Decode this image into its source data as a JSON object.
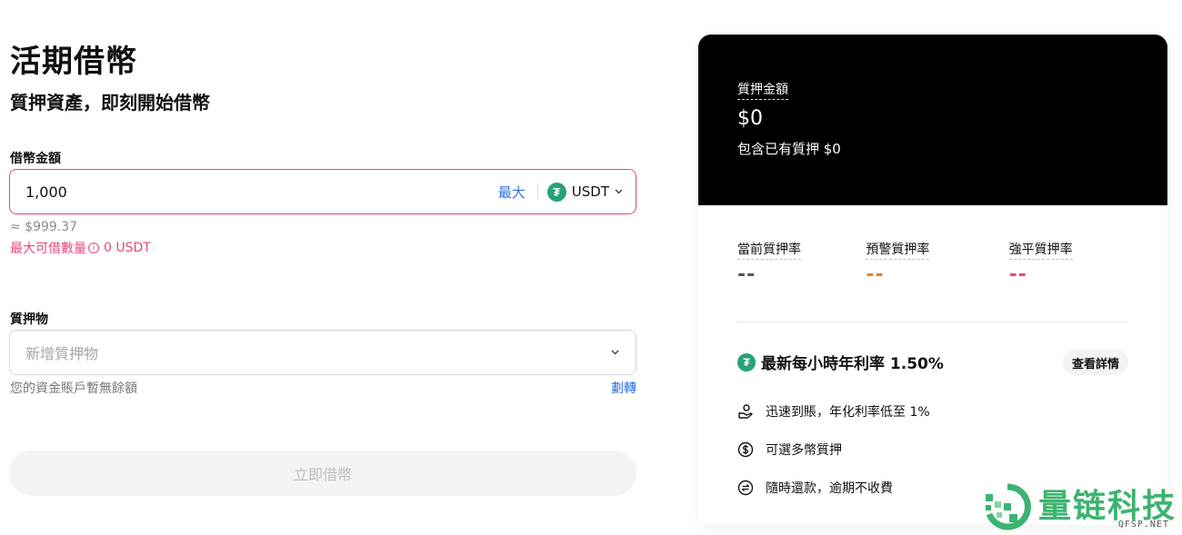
{
  "header": {
    "title": "活期借幣",
    "subtitle": "質押資產，即刻開始借幣"
  },
  "borrow": {
    "label": "借幣金額",
    "amount": "1,000",
    "max_label": "最大",
    "coin": "USDT",
    "approx": "≈ $999.37",
    "max_borrow_label": "最大可借數量",
    "max_borrow_value": "0 USDT"
  },
  "collateral": {
    "label": "質押物",
    "placeholder": "新增質押物",
    "no_balance": "您的資金賬戶暫無餘額",
    "transfer_label": "劃轉"
  },
  "submit_label": "立即借幣",
  "card": {
    "collateral_amount_label": "質押金額",
    "collateral_amount": "$0",
    "existing_collateral": "包含已有質押 $0",
    "rates": [
      {
        "label": "當前質押率",
        "value": "--"
      },
      {
        "label": "預警質押率",
        "value": "--"
      },
      {
        "label": "強平質押率",
        "value": "--"
      }
    ],
    "hourly_rate": "最新每小時年利率 1.50%",
    "details_label": "查看詳情",
    "features": [
      {
        "icon": "hand-coin-icon",
        "text": "迅速到賬，年化利率低至 1%"
      },
      {
        "icon": "dollar-circle-icon",
        "text": "可選多幣質押"
      },
      {
        "icon": "exchange-circle-icon",
        "text": "隨時還款，逾期不收費"
      }
    ]
  },
  "watermark": {
    "name": "量链科技",
    "domain": "QFSP.NET"
  },
  "colors": {
    "accent_pink": "#e4497a",
    "link_blue": "#2f6fde",
    "warning_orange": "#f07a2c",
    "tether_green": "#26a17b",
    "watermark_green": "#3cb371"
  }
}
